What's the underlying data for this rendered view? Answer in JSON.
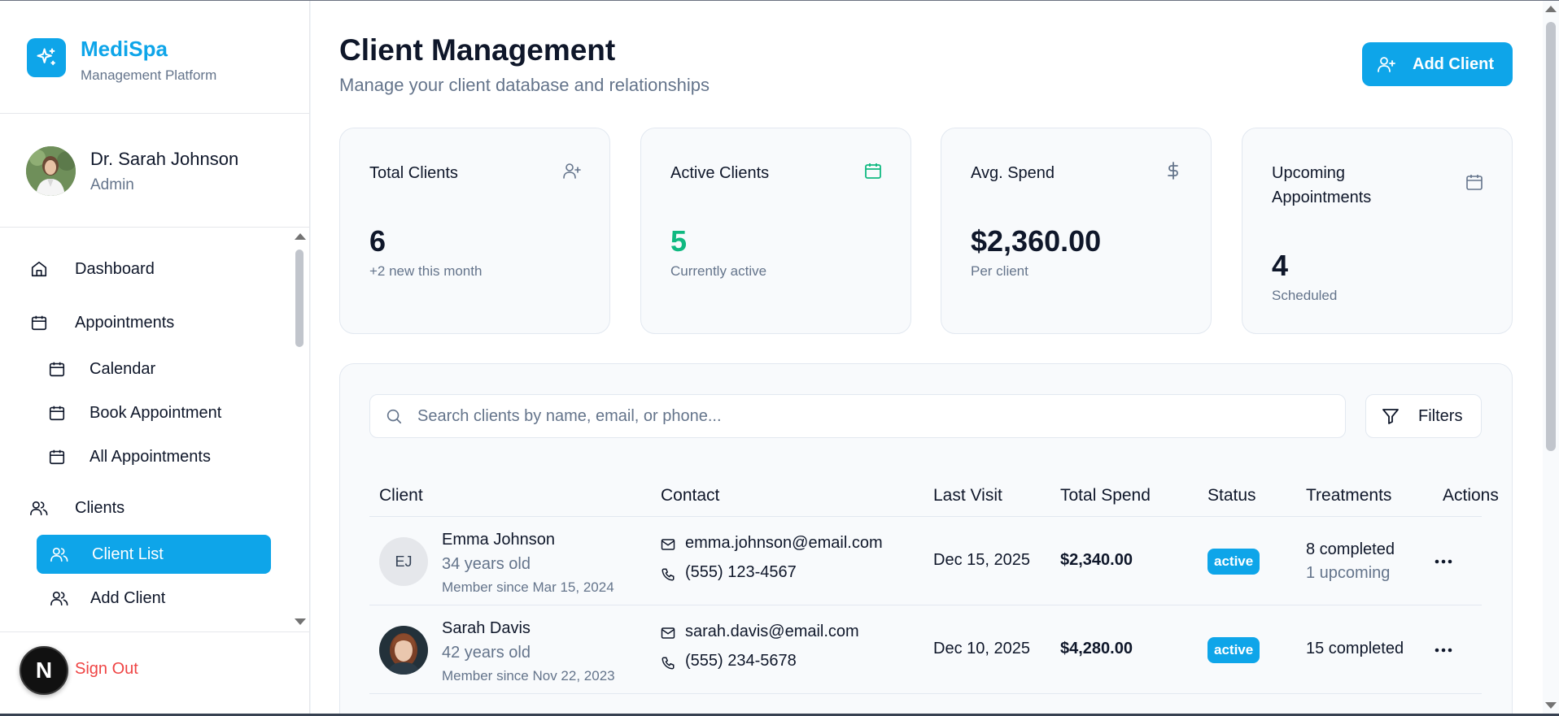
{
  "brand": {
    "name": "MediSpa",
    "subtitle": "Management Platform",
    "accent": "#0ea5e9",
    "icon": "sparkles-icon"
  },
  "user": {
    "name": "Dr. Sarah Johnson",
    "role": "Admin"
  },
  "nav": {
    "dashboard": "Dashboard",
    "appointments": "Appointments",
    "calendar": "Calendar",
    "book_appointment": "Book Appointment",
    "all_appointments": "All Appointments",
    "clients": "Clients",
    "client_list": "Client List",
    "add_client": "Add Client"
  },
  "sidebar_footer": {
    "badge": "N",
    "sign_out": "Sign Out"
  },
  "header": {
    "title": "Client Management",
    "subtitle": "Manage your client database and relationships",
    "add_button": "Add Client"
  },
  "stats": [
    {
      "title": "Total Clients",
      "value": "6",
      "note": "+2 new this month",
      "icon": "user-plus-icon"
    },
    {
      "title": "Active Clients",
      "value": "5",
      "note": "Currently active",
      "icon": "calendar-icon",
      "value_color": "#10b981"
    },
    {
      "title": "Avg. Spend",
      "value": "$2,360.00",
      "note": "Per client",
      "icon": "dollar-icon"
    },
    {
      "title": "Upcoming Appointments",
      "value": "4",
      "note": "Scheduled",
      "icon": "calendar-icon"
    }
  ],
  "search": {
    "placeholder": "Search clients by name, email, or phone...",
    "value": ""
  },
  "filters_label": "Filters",
  "table": {
    "headers": {
      "client": "Client",
      "contact": "Contact",
      "last_visit": "Last Visit",
      "total_spend": "Total Spend",
      "status": "Status",
      "treatments": "Treatments",
      "actions": "Actions"
    },
    "rows": [
      {
        "initials": "EJ",
        "name": "Emma Johnson",
        "age": "34 years old",
        "since": "Member since Mar 15, 2024",
        "email": "emma.johnson@email.com",
        "phone": "(555) 123-4567",
        "last_visit": "Dec 15, 2025",
        "total_spend": "$2,340.00",
        "status": "active",
        "treatments_completed": "8 completed",
        "treatments_upcoming": "1 upcoming"
      },
      {
        "initials": "",
        "name": "Sarah Davis",
        "age": "42 years old",
        "since": "Member since Nov 22, 2023",
        "email": "sarah.davis@email.com",
        "phone": "(555) 234-5678",
        "last_visit": "Dec 10, 2025",
        "total_spend": "$4,280.00",
        "status": "active",
        "treatments_completed": "15 completed"
      }
    ]
  }
}
